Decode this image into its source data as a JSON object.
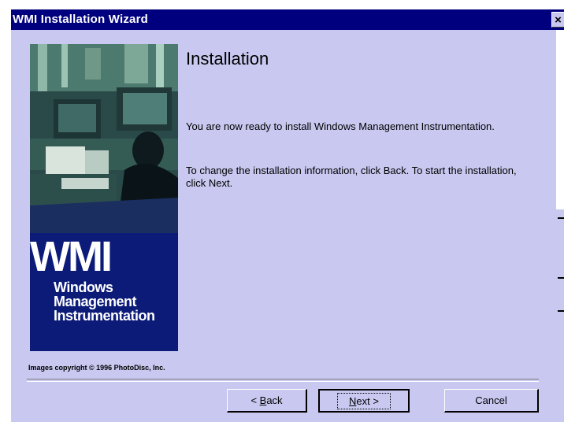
{
  "window": {
    "title": "WMI Installation Wizard",
    "close_glyph": "×"
  },
  "banner": {
    "logo": "WMI",
    "subtitle_lines": [
      "Windows",
      "Management",
      "Instrumentation"
    ]
  },
  "content": {
    "heading": "Installation",
    "paragraph_1": "You are now ready to install Windows Management Instrumentation.",
    "paragraph_2": "To change the installation information, click Back. To start the installation, click Next."
  },
  "footer": {
    "copyright": "Images copyright © 1996 PhotoDisc, Inc."
  },
  "buttons": {
    "back_prefix": "< ",
    "back_mnemonic": "B",
    "back_rest": "ack",
    "next_mnemonic": "N",
    "next_rest": "ext >",
    "cancel": "Cancel"
  },
  "colors": {
    "titlebar": "#00007e",
    "dialog_background": "#c8c8f0",
    "banner_background": "#0c1b78"
  },
  "icons": {
    "close": "close-icon"
  }
}
